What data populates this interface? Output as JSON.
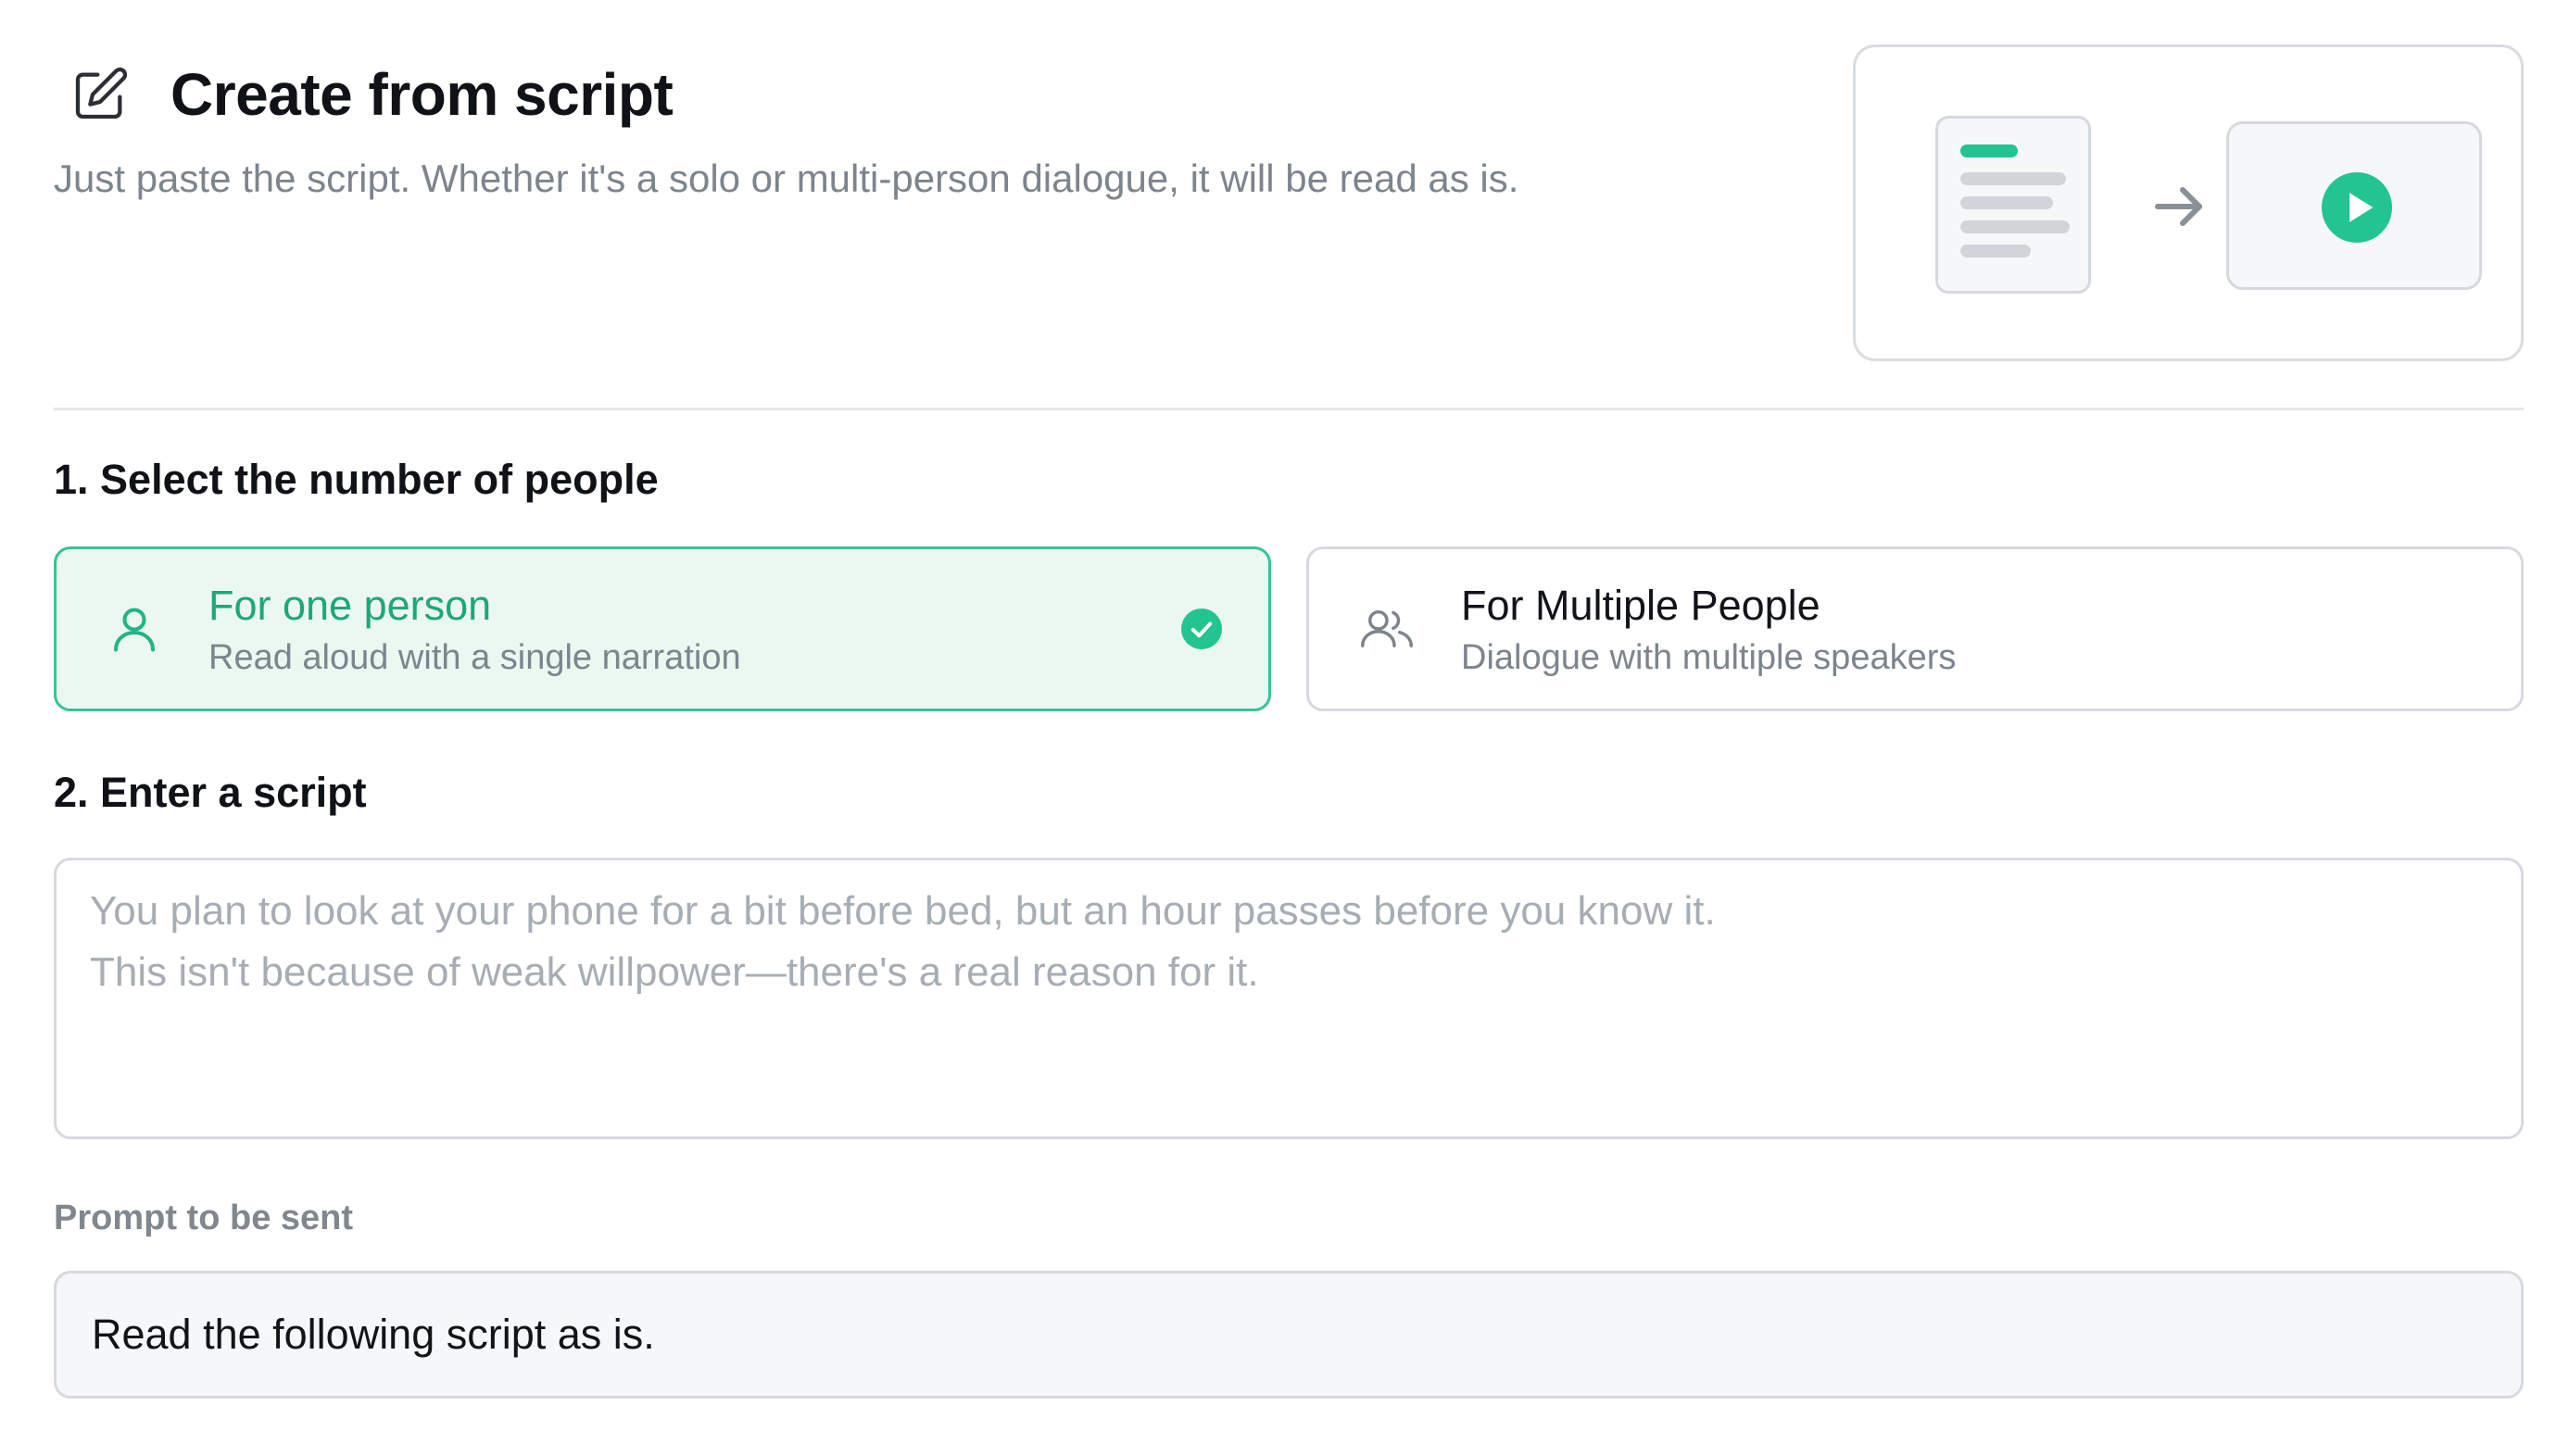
{
  "header": {
    "title": "Create from script",
    "subtitle": "Just paste the script. Whether it's a solo or multi-person dialogue, it will be read as is.",
    "title_icon": "edit-icon"
  },
  "illustration": {
    "icons": [
      "document-icon",
      "arrow-right-icon",
      "play-icon"
    ],
    "accent_color": "#22c48f"
  },
  "step1": {
    "label": "1. Select the number of people",
    "selected_option": "one_person",
    "options": [
      {
        "id": "one_person",
        "title": "For one person",
        "description": "Read aloud with a single narration",
        "icon": "person-icon",
        "selected": true
      },
      {
        "id": "multiple_people",
        "title": "For Multiple People",
        "description": "Dialogue with multiple speakers",
        "icon": "people-icon",
        "selected": false
      }
    ]
  },
  "step2": {
    "label": "2. Enter a script",
    "script_value": "",
    "placeholder": "You plan to look at your phone for a bit before bed, but an hour passes before you know it.\nThis isn't because of weak willpower—there's a real reason for it."
  },
  "prompt": {
    "label": "Prompt to be sent",
    "value": "Read the following script as is."
  },
  "colors": {
    "accent": "#22c48f",
    "selected_border": "#35c493",
    "selected_background": "#ebf7f1",
    "muted_text": "#7c848d",
    "border": "#d6dadf"
  }
}
